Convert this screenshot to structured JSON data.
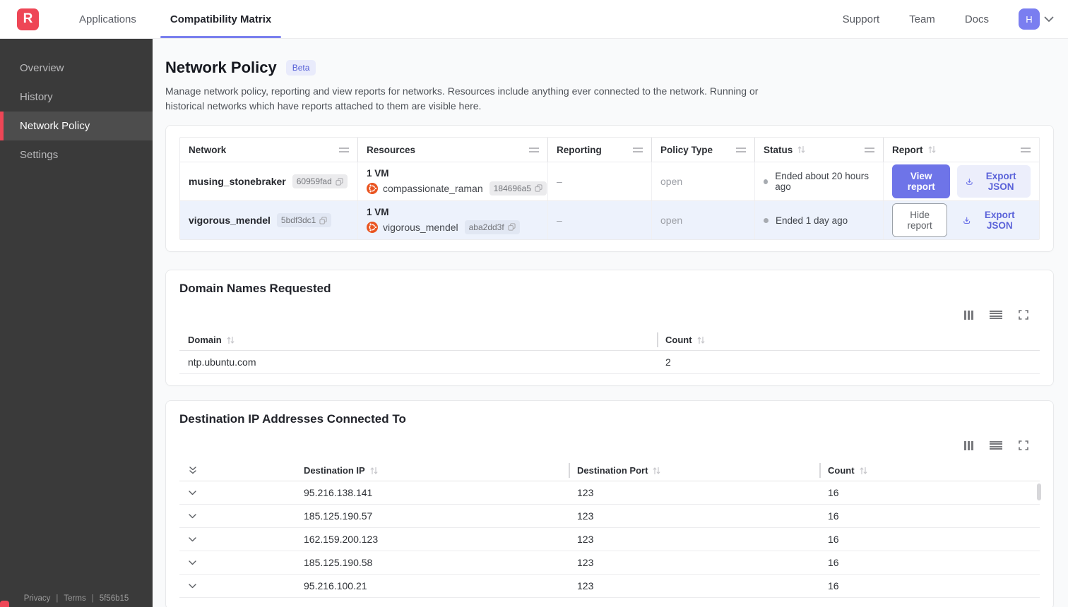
{
  "nav": {
    "logo_letter": "R",
    "tabs": {
      "applications": "Applications",
      "compatibility_matrix": "Compatibility Matrix"
    },
    "links": {
      "support": "Support",
      "team": "Team",
      "docs": "Docs"
    },
    "avatar_initial": "H"
  },
  "sidebar": {
    "items": [
      {
        "label": "Overview"
      },
      {
        "label": "History"
      },
      {
        "label": "Network Policy"
      },
      {
        "label": "Settings"
      }
    ],
    "footer": {
      "privacy": "Privacy",
      "terms": "Terms",
      "build": "5f56b15"
    }
  },
  "page": {
    "title": "Network Policy",
    "badge": "Beta",
    "description": "Manage network policy, reporting and view reports for networks. Resources include anything ever connected to the network. Running or historical networks which have reports attached to them are visible here."
  },
  "networks_table": {
    "columns": [
      "Network",
      "Resources",
      "Reporting",
      "Policy Type",
      "Status",
      "Report"
    ],
    "rows": [
      {
        "network_name": "musing_stonebraker",
        "network_id": "60959fad",
        "resources_summary": "1 VM",
        "resource_name": "compassionate_raman",
        "resource_id": "184696a5",
        "reporting": "–",
        "policy_type": "open",
        "status": "Ended about 20 hours ago",
        "report_button": "View report",
        "export_button": "Export JSON"
      },
      {
        "network_name": "vigorous_mendel",
        "network_id": "5bdf3dc1",
        "resources_summary": "1 VM",
        "resource_name": "vigorous_mendel",
        "resource_id": "aba2dd3f",
        "reporting": "–",
        "policy_type": "open",
        "status": "Ended 1 day ago",
        "report_button": "Hide report",
        "export_button": "Export JSON"
      }
    ]
  },
  "domains_card": {
    "title": "Domain Names Requested",
    "columns": {
      "domain": "Domain",
      "count": "Count"
    },
    "rows": [
      {
        "domain": "ntp.ubuntu.com",
        "count": "2"
      }
    ],
    "toolbar_icons": [
      "columns-icon",
      "rows-icon",
      "expand-icon"
    ]
  },
  "destinations_card": {
    "title": "Destination IP Addresses Connected To",
    "columns": {
      "ip": "Destination IP",
      "port": "Destination Port",
      "count": "Count"
    },
    "rows": [
      {
        "ip": "95.216.138.141",
        "port": "123",
        "count": "16"
      },
      {
        "ip": "185.125.190.57",
        "port": "123",
        "count": "16"
      },
      {
        "ip": "162.159.200.123",
        "port": "123",
        "count": "16"
      },
      {
        "ip": "185.125.190.58",
        "port": "123",
        "count": "16"
      },
      {
        "ip": "95.216.100.21",
        "port": "123",
        "count": "16"
      }
    ],
    "toolbar_icons": [
      "columns-icon",
      "rows-icon",
      "expand-icon"
    ]
  },
  "colors": {
    "brand_red": "#ee4656",
    "accent_purple": "#6e74e8",
    "selected_row_bg": "#edf2fc",
    "sidebar_bg": "#3a3a3a"
  }
}
